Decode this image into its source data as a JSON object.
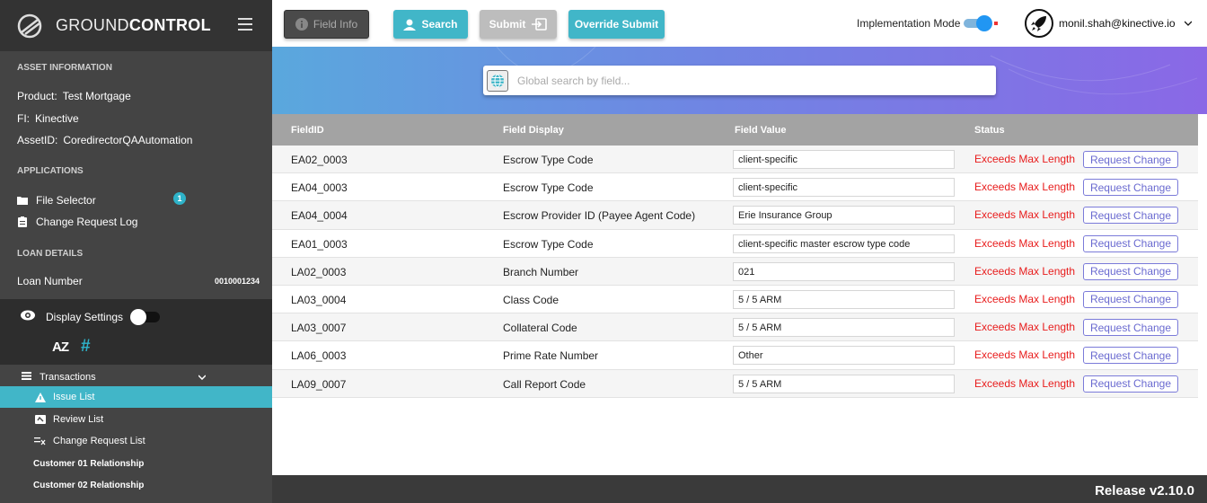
{
  "brand": {
    "name_light": "GROUND",
    "name_bold": "CONTROL"
  },
  "sidebar": {
    "asset_title": "ASSET INFORMATION",
    "product_label": "Product:",
    "product_value": "Test Mortgage",
    "fi_label": "FI:",
    "fi_value": "Kinective",
    "asset_label": "AssetID:",
    "asset_value": "CoredirectorQAAutomation",
    "apps_title": "APPLICATIONS",
    "file_selector": "File Selector",
    "file_selector_badge": "1",
    "change_log": "Change Request Log",
    "loan_title": "LOAN DETAILS",
    "loan_label": "Loan Number",
    "loan_value": "0010001234",
    "display_settings": "Display Settings",
    "sort_az": "AZ",
    "sort_hash": "#",
    "transactions": "Transactions",
    "nav": [
      "Issue List",
      "Review List",
      "Change Request List",
      "Customer 01 Relationship",
      "Customer 02 Relationship"
    ]
  },
  "toolbar": {
    "field_info": "Field Info",
    "search": "Search",
    "submit": "Submit",
    "override_submit": "Override Submit",
    "implementation_mode": "Implementation Mode",
    "user": "monil.shah@kinective.io"
  },
  "search": {
    "placeholder": "Global search by field..."
  },
  "table": {
    "headers": [
      "FieldID",
      "Field Display",
      "Field Value",
      "Status"
    ],
    "rows": [
      {
        "id": "EA02_0003",
        "display": "Escrow Type Code",
        "value": "client-specific",
        "status": "Exceeds Max Length",
        "action": "Request Change"
      },
      {
        "id": "EA04_0003",
        "display": "Escrow Type Code",
        "value": "client-specific",
        "status": "Exceeds Max Length",
        "action": "Request Change"
      },
      {
        "id": "EA04_0004",
        "display": "Escrow Provider ID (Payee Agent Code)",
        "value": "Erie Insurance Group",
        "status": "Exceeds Max Length",
        "action": "Request Change"
      },
      {
        "id": "EA01_0003",
        "display": "Escrow Type Code",
        "value": "client-specific master escrow type code",
        "status": "Exceeds Max Length",
        "action": "Request Change"
      },
      {
        "id": "LA02_0003",
        "display": "Branch Number",
        "value": "021",
        "status": "Exceeds Max Length",
        "action": "Request Change"
      },
      {
        "id": "LA03_0004",
        "display": "Class Code",
        "value": "5 / 5 ARM",
        "status": "Exceeds Max Length",
        "action": "Request Change"
      },
      {
        "id": "LA03_0007",
        "display": "Collateral Code",
        "value": "5 / 5 ARM",
        "status": "Exceeds Max Length",
        "action": "Request Change"
      },
      {
        "id": "LA06_0003",
        "display": "Prime Rate Number",
        "value": "Other",
        "status": "Exceeds Max Length",
        "action": "Request Change"
      },
      {
        "id": "LA09_0007",
        "display": "Call Report Code",
        "value": "5 / 5 ARM",
        "status": "Exceeds Max Length",
        "action": "Request Change"
      }
    ]
  },
  "footer": {
    "release": "Release v2.10.0"
  },
  "colors": {
    "accent": "#41b6c8",
    "error": "#e81c1c",
    "action": "#6a6ad0",
    "sidebar": "#444444"
  }
}
